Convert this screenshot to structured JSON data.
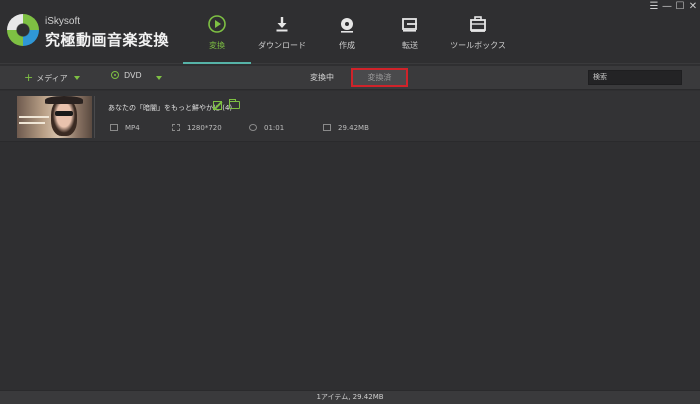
{
  "app": {
    "brand_small": "iSkysoft",
    "brand_title": "究極動画音楽変換"
  },
  "nav": {
    "tabs": [
      {
        "label": "変換",
        "icon": "play-circle-icon",
        "active": true
      },
      {
        "label": "ダウンロード",
        "icon": "download-icon",
        "active": false
      },
      {
        "label": "作成",
        "icon": "disc-icon",
        "active": false
      },
      {
        "label": "転送",
        "icon": "transfer-icon",
        "active": false
      },
      {
        "label": "ツールボックス",
        "icon": "toolbox-icon",
        "active": false
      }
    ]
  },
  "window_controls": {
    "menu": "☰",
    "minimize": "—",
    "maximize": "☐",
    "close": "✕"
  },
  "toolbar": {
    "add_media_plus": "+",
    "add_media_label": "メディア",
    "dvd_label": "DVD",
    "segment_converting": "変換中",
    "segment_converted": "変換済",
    "search_placeholder": "検索"
  },
  "file": {
    "name": "あなたの「暗闇」をもっと鮮やかに (4)",
    "format": "MP4",
    "resolution": "1280*720",
    "duration": "01:01",
    "size": "29.42MB"
  },
  "status": {
    "summary": "1アイテム, 29.42MB"
  },
  "colors": {
    "accent_green": "#7ec043",
    "accent_teal": "#56b3a8",
    "highlight_red": "#d0232a",
    "background": "#2f2f31"
  }
}
